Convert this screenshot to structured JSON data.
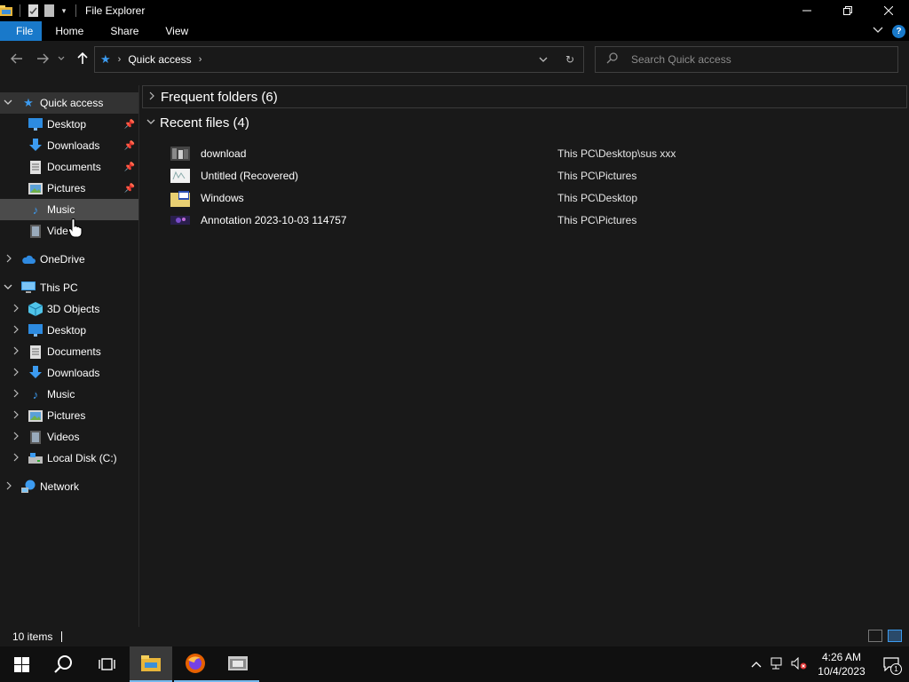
{
  "window": {
    "title": "File Explorer"
  },
  "ribbon": {
    "tabs": [
      "File",
      "Home",
      "Share",
      "View"
    ]
  },
  "address": {
    "crumb": "Quick access"
  },
  "search": {
    "placeholder": "Search Quick access"
  },
  "navpane": {
    "quick_access": "Quick access",
    "quick_items": [
      "Desktop",
      "Downloads",
      "Documents",
      "Pictures",
      "Music",
      "Vide"
    ],
    "onedrive": "OneDrive",
    "this_pc": "This PC",
    "pc_items": [
      "3D Objects",
      "Desktop",
      "Documents",
      "Downloads",
      "Music",
      "Pictures",
      "Videos",
      "Local Disk (C:)"
    ],
    "network": "Network"
  },
  "content": {
    "frequent_label": "Frequent folders (6)",
    "recent_label": "Recent files (4)",
    "recent_files": [
      {
        "name": "download",
        "location": "This PC\\Desktop\\sus xxx"
      },
      {
        "name": "Untitled (Recovered)",
        "location": "This PC\\Pictures"
      },
      {
        "name": "Windows",
        "location": "This PC\\Desktop"
      },
      {
        "name": "Annotation 2023-10-03 114757",
        "location": "This PC\\Pictures"
      }
    ]
  },
  "status": {
    "count": "10 items"
  },
  "taskbar": {
    "time": "4:26 AM",
    "date": "10/4/2023",
    "notification_count": "1"
  },
  "colors": {
    "accent": "#1979ca",
    "background": "#191919",
    "selection": "#333333"
  }
}
